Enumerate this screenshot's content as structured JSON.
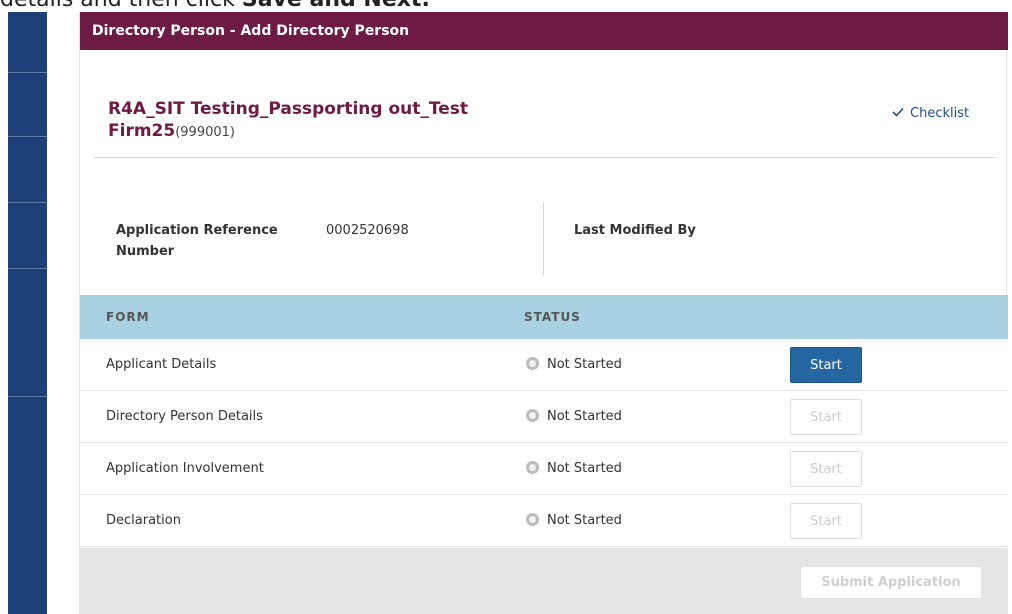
{
  "caption": {
    "prefix": "details and then click ",
    "bold": "Save and Next."
  },
  "panel": {
    "header_title": "Directory Person - Add Directory Person",
    "firm_name": "R4A_SIT Testing_Passporting out_Test Firm25",
    "firm_code": "(999001)",
    "checklist_label": "Checklist",
    "checklist_icon": "check-icon"
  },
  "info": {
    "reference_label": "Application Reference Number",
    "reference_value": "0002520698",
    "last_modified_label": "Last Modified By"
  },
  "table": {
    "headers": {
      "form": "FORM",
      "status": "STATUS"
    },
    "rows": [
      {
        "form": "Applicant Details",
        "status": "Not Started",
        "action": "Start",
        "enabled": true
      },
      {
        "form": "Directory Person Details",
        "status": "Not Started",
        "action": "Start",
        "enabled": false
      },
      {
        "form": "Application Involvement",
        "status": "Not Started",
        "action": "Start",
        "enabled": false
      },
      {
        "form": "Declaration",
        "status": "Not Started",
        "action": "Start",
        "enabled": false
      }
    ]
  },
  "footer": {
    "submit_label": "Submit Application"
  },
  "colors": {
    "header_bg": "#6d1a45",
    "sidebar_bg": "#1d3f77",
    "table_head_bg": "#a8d1e2",
    "primary_button": "#2466a0"
  }
}
